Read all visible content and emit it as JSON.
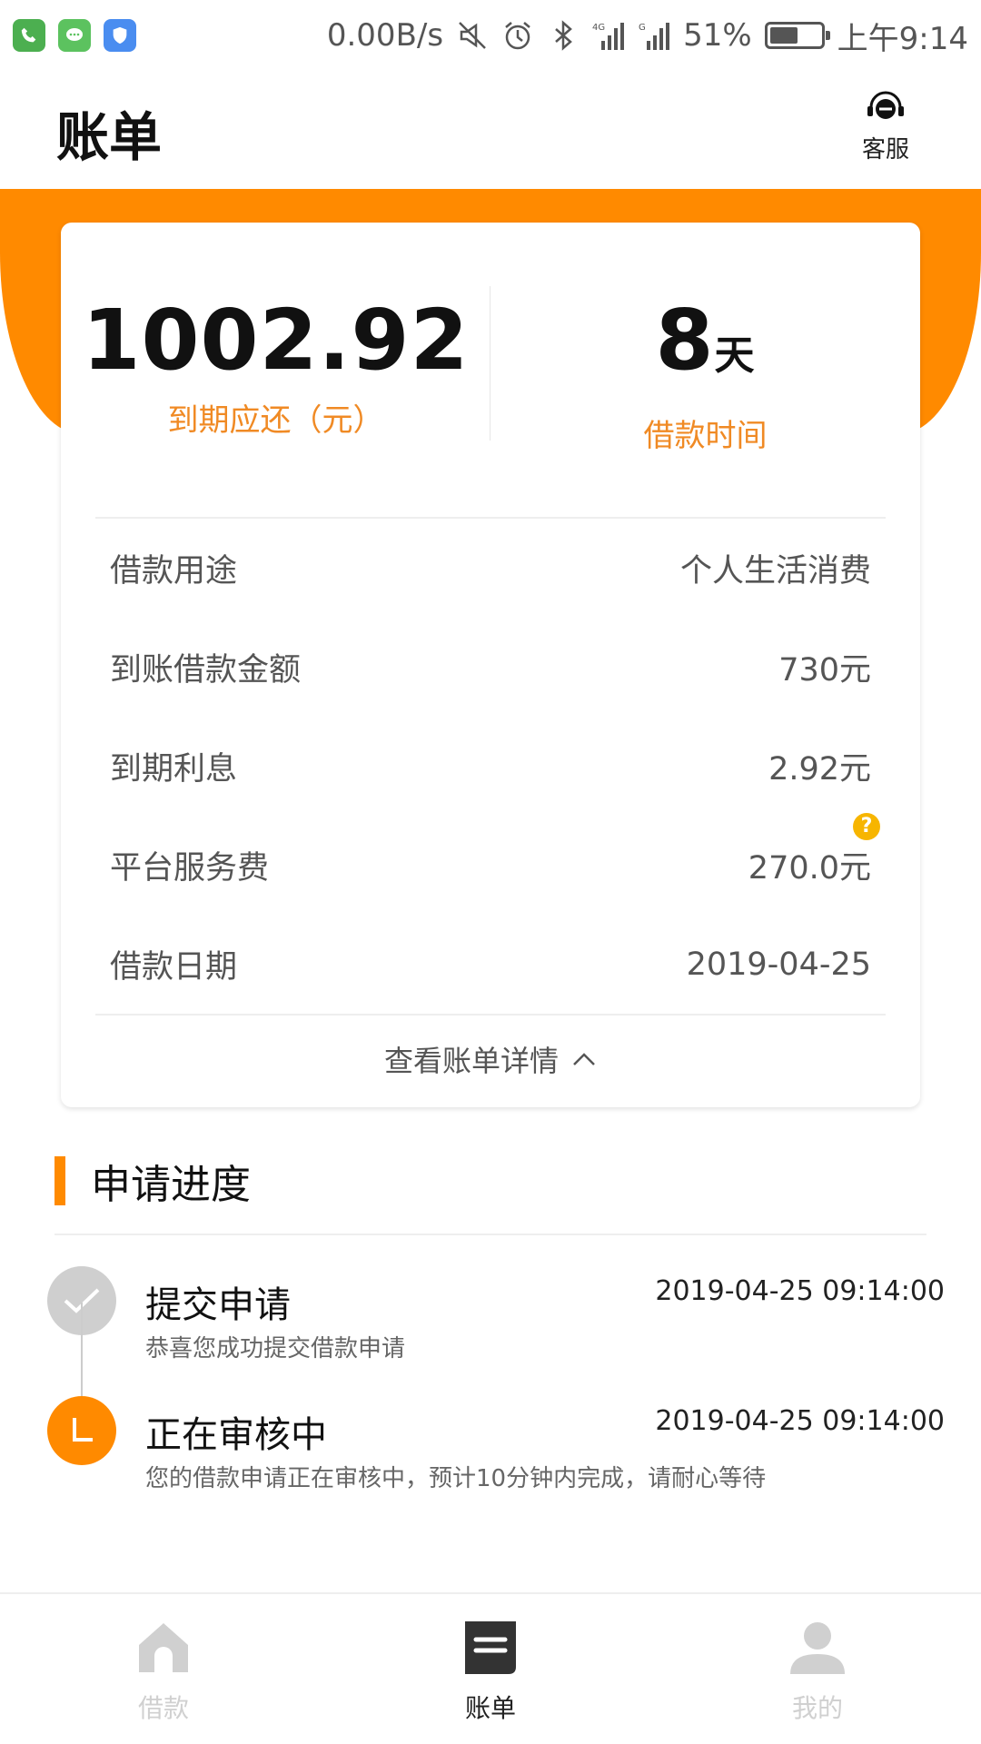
{
  "status_bar": {
    "net_speed": "0.00B/s",
    "battery_pct": "51%",
    "time": "上午9:14"
  },
  "header": {
    "title": "账单",
    "customer_service_label": "客服"
  },
  "summary": {
    "amount_value": "1002.92",
    "amount_label": "到期应还（元）",
    "days_value": "8",
    "days_unit": "天",
    "days_label": "借款时间"
  },
  "details": [
    {
      "label": "借款用途",
      "value": "个人生活消费"
    },
    {
      "label": "到账借款金额",
      "value": "730元"
    },
    {
      "label": "到期利息",
      "value": "2.92元"
    },
    {
      "label": "平台服务费",
      "value": "270.0元"
    },
    {
      "label": "借款日期",
      "value": "2019-04-25"
    }
  ],
  "help_glyph": "?",
  "detail_toggle_label": "查看账单详情",
  "progress": {
    "title": "申请进度",
    "steps": [
      {
        "title": "提交申请",
        "desc": "恭喜您成功提交借款申请",
        "time": "2019-04-25 09:14:00"
      },
      {
        "title": "正在审核中",
        "desc": "您的借款申请正在审核中，预计10分钟内完成，请耐心等待",
        "time": "2019-04-25 09:14:00"
      }
    ]
  },
  "nav": {
    "items": [
      {
        "label": "借款"
      },
      {
        "label": "账单"
      },
      {
        "label": "我的"
      }
    ]
  },
  "colors": {
    "accent": "#ff8a00",
    "label_orange": "#f08a24",
    "help_yellow": "#f7b500",
    "nav_inactive": "#d0d0d0"
  }
}
